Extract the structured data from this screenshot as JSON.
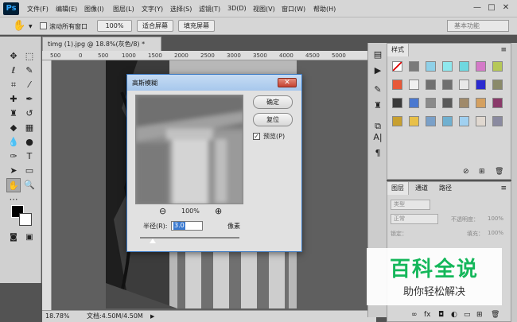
{
  "app": {
    "logo": "Ps"
  },
  "menu": [
    "文件(F)",
    "编辑(E)",
    "图像(I)",
    "图层(L)",
    "文字(Y)",
    "选择(S)",
    "滤镜(T)",
    "3D(D)",
    "视图(V)",
    "窗口(W)",
    "帮助(H)"
  ],
  "window_controls": {
    "minimize": "—",
    "maximize": "□",
    "close": "✕"
  },
  "options_bar": {
    "scroll_all_label": "滚动所有窗口",
    "zoom_value": "100%",
    "fit_screen": "适合屏幕",
    "fill_screen": "填充屏幕",
    "workspace": "基本功能"
  },
  "document": {
    "tab_title": "timg (1).jpg @ 18.8%(灰色/8) *",
    "ruler_ticks": [
      "500",
      "0",
      "500",
      "1000",
      "1500",
      "2000",
      "2500",
      "3000",
      "3500",
      "4000",
      "4500",
      "5000"
    ],
    "status_zoom": "18.78%",
    "status_doc": "文档:4.50M/4.50M"
  },
  "styles_panel": {
    "tab": "样式"
  },
  "layers_panel": {
    "tabs": [
      "图层",
      "通道",
      "路径"
    ],
    "kind": "类型",
    "blend_mode": "正常",
    "opacity_label": "不透明度：",
    "opacity_value": "100%",
    "lock_label": "锁定：",
    "fill_label": "填充：",
    "fill_value": "100%"
  },
  "dialog": {
    "title": "高斯模糊",
    "ok": "确定",
    "reset": "复位",
    "preview_label": "预览(P)",
    "preview_checked": true,
    "zoom_out": "⊖",
    "zoom_value": "100%",
    "zoom_in": "⊕",
    "radius_label": "半径(R):",
    "radius_value": "3.0",
    "radius_unit": "像素",
    "close_glyph": "✕",
    "slider_fraction": 0.13
  },
  "watermark": {
    "title": "百科全说",
    "subtitle": "助你轻松解决",
    "color": "#14b75a"
  }
}
